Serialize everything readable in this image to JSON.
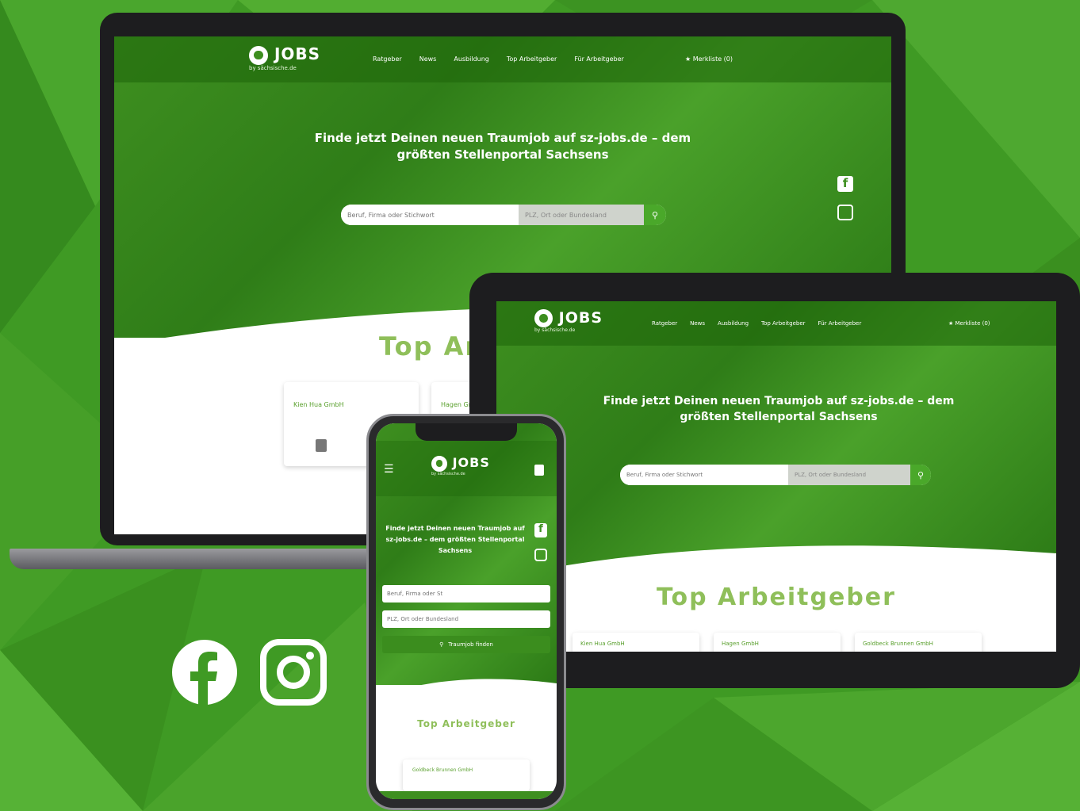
{
  "colors": {
    "brand_green": "#3e8f20",
    "accent_green": "#4aa82a",
    "title_green": "#8fbf5a",
    "frame_dark": "#1d1d1f"
  },
  "site": {
    "logo_text": "JOBS",
    "logo_sub": "by sächsische.de",
    "nav": [
      "Ratgeber",
      "News",
      "Ausbildung",
      "Top Arbeitgeber",
      "Für Arbeitgeber"
    ],
    "nav_right": "Merkliste (0)",
    "headline_line1": "Finde jetzt Deinen neuen Traumjob auf sz-jobs.de – dem",
    "headline_line2": "größten Stellenportal Sachsens",
    "search_placeholder": "Beruf, Firma oder Stichwort",
    "location_placeholder": "PLZ, Ort oder Bundesland",
    "search_icon": "search-icon",
    "top_title": "Top Arbeitgeber",
    "laptop_top_title": "Top Ar",
    "cards": [
      "Kien Hua GmbH",
      "Hagen GmbH",
      "Goldbeck Brunnen GmbH"
    ]
  },
  "phone": {
    "headline": "Finde jetzt Deinen neuen Traumjob auf sz-jobs.de – dem größten Stellenportal Sachsens",
    "search_placeholder": "Beruf, Firma oder St",
    "location_placeholder": "PLZ, Ort oder Bundesland",
    "find_button": "Traumjob finden",
    "top_title": "Top Arbeitgeber",
    "card": "Goldbeck Brunnen GmbH"
  },
  "footer_icons": [
    "facebook-icon",
    "instagram-icon"
  ]
}
